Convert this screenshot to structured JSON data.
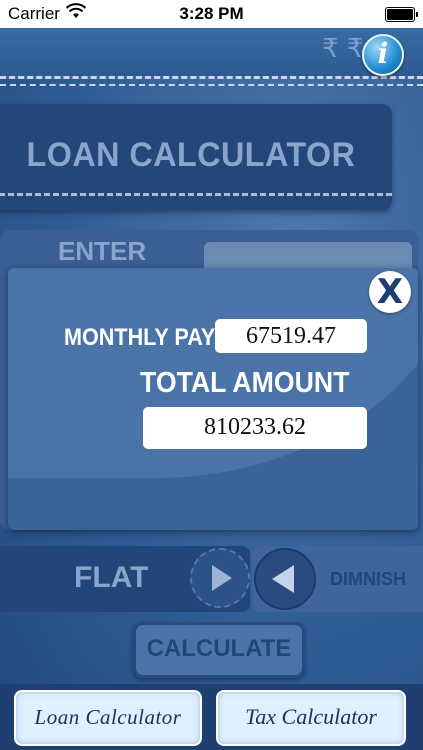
{
  "status_bar": {
    "carrier": "Carrier",
    "time": "3:28 PM"
  },
  "header": {
    "info_icon": "i",
    "title": "LOAN CALCULATOR"
  },
  "form": {
    "enter_label": "ENTER"
  },
  "result_popup": {
    "close_icon": "X",
    "monthly_pay_label": "MONTHLY PAY",
    "monthly_pay_value": "67519.47",
    "total_amount_label": "TOTAL AMOUNT",
    "total_amount_value": "810233.62"
  },
  "interest_type": {
    "flat_label": "FLAT",
    "dimnish_label": "DIMNISH"
  },
  "calculate_button": "CALCULATE",
  "bottom_tabs": {
    "loan": "Loan  Calculator",
    "tax": "Tax Calculator"
  },
  "colors": {
    "background": "#2f5a92",
    "panel_dark": "#23467a",
    "accent_text": "#8aa5cc",
    "tab_bg": "#dff0ff"
  }
}
